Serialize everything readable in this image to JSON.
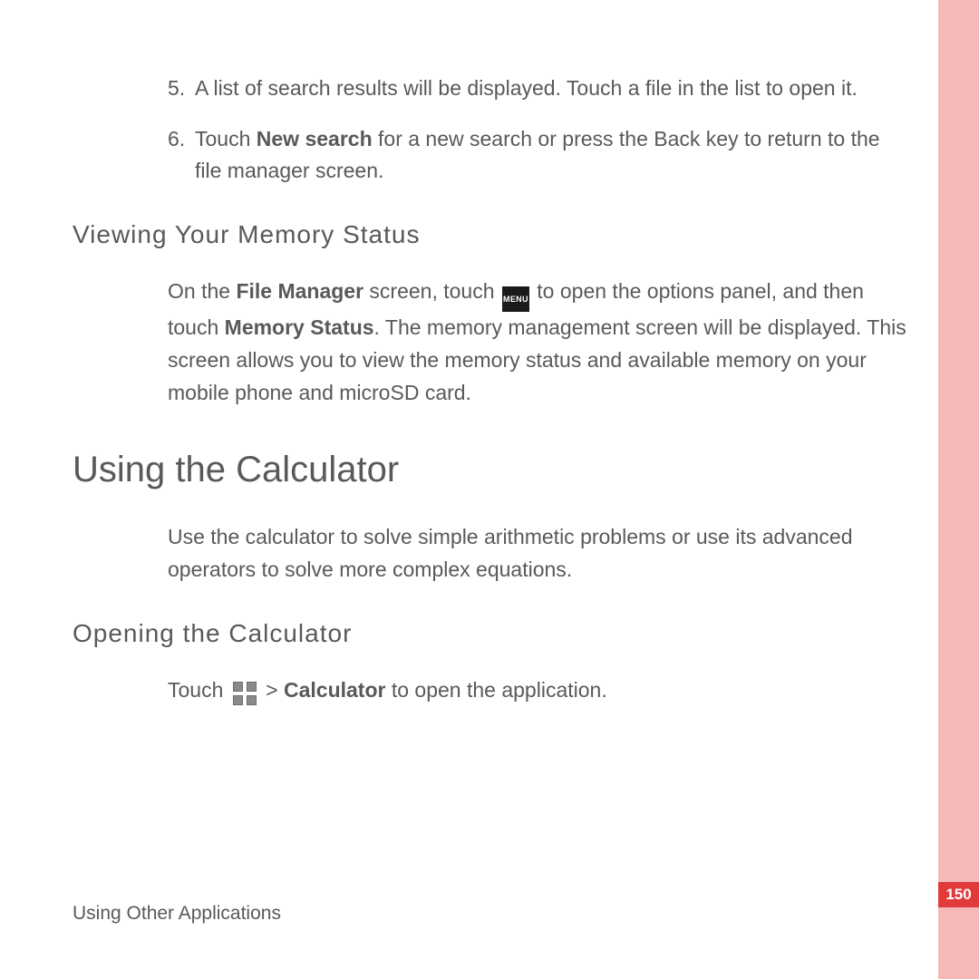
{
  "list": [
    {
      "num": "5.",
      "pre": "A list of search results will be displayed. Touch a file in the list to open it."
    },
    {
      "num": "6.",
      "pre": "Touch ",
      "bold1": "New search",
      "post1": " for a new search or press the Back key to return to the file manager screen."
    }
  ],
  "memory": {
    "heading": "Viewing  Your  Memory  Status",
    "p1a": "On the ",
    "p1b": "File Manager",
    "p1c": " screen, touch ",
    "menu_label": "MENU",
    "p1d": " to open the options panel, and then touch ",
    "p1e": "Memory Status",
    "p1f": ". The memory management screen will be displayed. This screen allows you to view the memory status and available memory on your mobile phone and microSD card."
  },
  "calc": {
    "heading": "Using the Calculator",
    "intro": "Use the calculator to solve simple arithmetic problems or use its advanced operators to solve more complex equations.",
    "open_heading": "Opening  the  Calculator",
    "open_a": "Touch ",
    "open_b": " > ",
    "open_c": "Calculator",
    "open_d": " to open the application."
  },
  "footer": "Using Other Applications",
  "page_number": "150"
}
